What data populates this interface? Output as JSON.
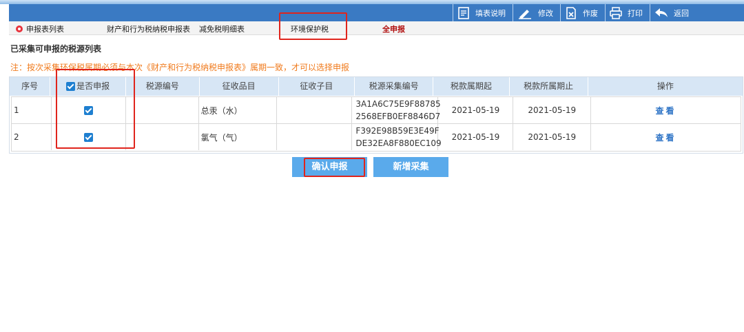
{
  "toolbar": {
    "items": [
      {
        "label": "填表说明",
        "icon": "document-icon"
      },
      {
        "label": "修改",
        "icon": "edit-icon"
      },
      {
        "label": "作废",
        "icon": "void-icon"
      },
      {
        "label": "打印",
        "icon": "printer-icon"
      },
      {
        "label": "返回",
        "icon": "back-icon"
      }
    ]
  },
  "tabs": {
    "items": [
      "申报表列表",
      "财产和行为税纳税申报表",
      "减免税明细表",
      "环境保护税",
      "全申报"
    ]
  },
  "section": {
    "title": "已采集可申报的税源列表",
    "notice": "注：按次采集环保税属期必须与本次《财产和行为税纳税申报表》属期一致，才可以选择申报"
  },
  "table": {
    "headers": [
      "序号",
      "是否申报",
      "税源编号",
      "征收品目",
      "征收子目",
      "税源采集编号",
      "税款属期起",
      "税款所属期止",
      "操作"
    ],
    "rows": [
      {
        "index": "1",
        "checked": true,
        "source_no": "",
        "item": "总汞（水）",
        "subitem": "",
        "code_line1": "3A1A6C75E9F88785",
        "code_line2": "2568EFB0EF8846D7",
        "start": "2021-05-19",
        "end": "2021-05-19",
        "action": "查看"
      },
      {
        "index": "2",
        "checked": true,
        "source_no": "",
        "item": "氯气（气）",
        "subitem": "",
        "code_line1": "F392E98B59E3E49F",
        "code_line2": "DE32EA8F880EC109",
        "start": "2021-05-19",
        "end": "2021-05-19",
        "action": "查看"
      }
    ]
  },
  "buttons": {
    "confirm": "确认申报",
    "add": "新增采集"
  },
  "colors": {
    "header_bar": "#3a7ac3",
    "accent_button": "#5aaaeb",
    "highlight": "#e0241c",
    "notice": "#f07a1c"
  }
}
